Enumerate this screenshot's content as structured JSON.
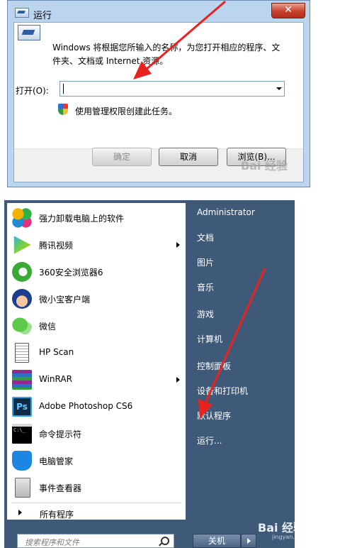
{
  "run_dialog": {
    "title": "运行",
    "close_glyph": "✕",
    "description": "Windows 将根据您所输入的名称，为您打开相应的程序、文件夹、文档或 Internet 资源。",
    "open_label": "打开(O):",
    "open_value": "",
    "admin_note": "使用管理权限创建此任务。",
    "ok_label": "确定",
    "cancel_label": "取消",
    "browse_label": "浏览(B)..."
  },
  "start_menu": {
    "programs": [
      {
        "label": "强力卸载电脑上的软件",
        "icon": "uninstaller-icon",
        "has_submenu": false
      },
      {
        "label": "腾讯视频",
        "icon": "tencent-video-icon",
        "has_submenu": true
      },
      {
        "label": "360安全浏览器6",
        "icon": "360-browser-icon",
        "has_submenu": false
      },
      {
        "label": "微小宝客户端",
        "icon": "weixiaobao-icon",
        "has_submenu": false
      },
      {
        "label": "微信",
        "icon": "wechat-icon",
        "has_submenu": false
      },
      {
        "label": "HP Scan",
        "icon": "hp-scan-icon",
        "has_submenu": false
      },
      {
        "label": "WinRAR",
        "icon": "winrar-icon",
        "has_submenu": true
      },
      {
        "label": "Adobe Photoshop CS6",
        "icon": "photoshop-icon",
        "has_submenu": false
      },
      {
        "label": "命令提示符",
        "icon": "cmd-icon",
        "has_submenu": false
      },
      {
        "label": "电脑管家",
        "icon": "pc-manager-icon",
        "has_submenu": false
      },
      {
        "label": "事件查看器",
        "icon": "event-viewer-icon",
        "has_submenu": false
      }
    ],
    "all_programs": "所有程序",
    "search_placeholder": "搜索程序和文件",
    "right_items": [
      "Administrator",
      "文档",
      "图片",
      "音乐",
      "游戏",
      "计算机",
      "控制面板",
      "设备和打印机",
      "默认程序",
      "运行..."
    ],
    "shutdown_label": "关机"
  },
  "watermark": {
    "brand": "Bai 经验",
    "url": "jingyan.baidu.com"
  },
  "colors": {
    "arrow_red": "#e8231f",
    "start_menu_bg": "#3e5a78",
    "dialog_frame": "#bcd5ee"
  }
}
